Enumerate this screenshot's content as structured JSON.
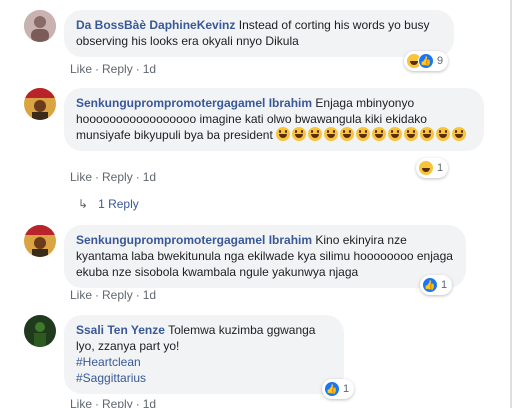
{
  "comments": [
    {
      "author": "Da BossBàè DaphineKevinz",
      "text": "Instead of corting his words yo busy observing his looks era okyali nnyo Dikula",
      "actions": {
        "like": "Like",
        "reply": "Reply",
        "time": "1d"
      },
      "reactions": {
        "icons": [
          "haha-icon",
          "like-icon"
        ],
        "count": "9"
      },
      "avatar_color": "#c9b3b0"
    },
    {
      "author": "Senkunguprompromotergagamel Ibrahim",
      "text": "Enjaga mbinyonyo hooooooooooooooooo imagine kati olwo bwawangula kiki ekidako munsiyafe bikyupuli bya ba president",
      "emoji_run_count": 12,
      "actions": {
        "like": "Like",
        "reply": "Reply",
        "time": "1d"
      },
      "reactions": {
        "icons": [
          "haha-icon"
        ],
        "count": "1"
      },
      "avatar_color": "#d9a441"
    },
    {
      "author": "Senkunguprompromotergagamel Ibrahim",
      "text": "Kino ekinyira nze kyantama laba bwekitunula nga ekilwade kya silimu hoooooooo enjaga ekuba nze sisobola kwambala ngule yakunwya njaga",
      "actions": {
        "like": "Like",
        "reply": "Reply",
        "time": "1d"
      },
      "reactions": {
        "icons": [
          "like-icon"
        ],
        "count": "1"
      },
      "avatar_color": "#d9a441"
    },
    {
      "author": "Ssali Ten Yenze",
      "text": "Tolemwa kuzimba ggwanga lyo, zzanya part yo!",
      "hashtags": [
        "#Heartclean",
        "#Saggittarius"
      ],
      "actions": {
        "like": "Like",
        "reply": "Reply",
        "time": "1d"
      },
      "reactions": {
        "icons": [
          "like-icon"
        ],
        "count": "1"
      },
      "avatar_color": "#1f3a1c"
    }
  ],
  "replies_link": "1 Reply",
  "colors": {
    "link": "#385898",
    "bubble": "#f2f3f5",
    "meta": "#606770"
  }
}
